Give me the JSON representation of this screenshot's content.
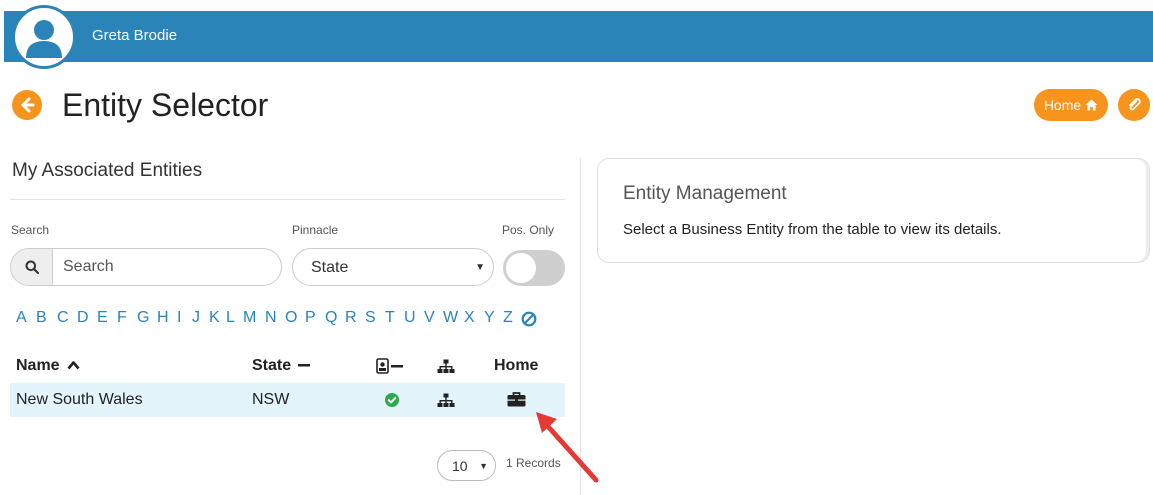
{
  "header": {
    "user_name": "Greta Brodie",
    "bar_color": "#2a84b8"
  },
  "page": {
    "title": "Entity Selector",
    "home_label": "Home",
    "accent": "#f7941d"
  },
  "entities_panel": {
    "title": "My Associated Entities",
    "search_label": "Search",
    "search_placeholder": "Search",
    "pinnacle_label": "Pinnacle",
    "pinnacle_value": "State",
    "pos_only_label": "Pos. Only",
    "pos_only_on": false,
    "alphabet": [
      "A",
      "B",
      "C",
      "D",
      "E",
      "F",
      "G",
      "H",
      "I",
      "J",
      "K",
      "L",
      "M",
      "N",
      "O",
      "P",
      "Q",
      "R",
      "S",
      "T",
      "U",
      "V",
      "W",
      "X",
      "Y",
      "Z"
    ],
    "columns": {
      "name": "Name",
      "state": "State",
      "home": "Home"
    },
    "rows": [
      {
        "name": "New South Wales",
        "state": "NSW",
        "positional": true,
        "hierarchy_icon": "sitemap-icon",
        "home_icon": "briefcase-icon"
      }
    ],
    "page_size": "10",
    "records_text": "1 Records"
  },
  "management_card": {
    "title": "Entity Management",
    "text": "Select a Business Entity from the table to view its details."
  }
}
